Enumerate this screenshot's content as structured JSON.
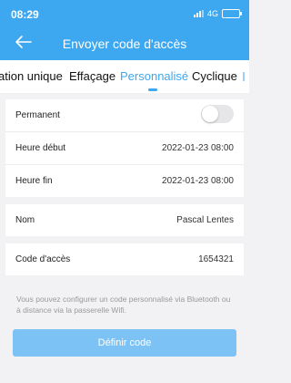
{
  "status": {
    "time": "08:29",
    "network": "4G"
  },
  "header": {
    "title": "Envoyer code d'accès"
  },
  "tabs": [
    {
      "label": "ation unique"
    },
    {
      "label": "Effaçage"
    },
    {
      "label": "Personnalisé"
    },
    {
      "label": "Cyclique"
    }
  ],
  "form": {
    "permanent_label": "Permanent",
    "permanent_enabled": false,
    "start_label": "Heure début",
    "start_value": "2022-01-23 08:00",
    "end_label": "Heure fin",
    "end_value": "2022-01-23 08:00",
    "name_label": "Nom",
    "name_value": "Pascal Lentes",
    "code_label": "Code d'accès",
    "code_value": "1654321"
  },
  "note": "Vous pouvez configurer un code personnalisé via Bluetooth ou à distance via la passerelle Wifi.",
  "submit_label": "Définir code",
  "colors": {
    "accent": "#3da7f0",
    "button": "#7cc2f5",
    "background": "#f2f2f4"
  }
}
